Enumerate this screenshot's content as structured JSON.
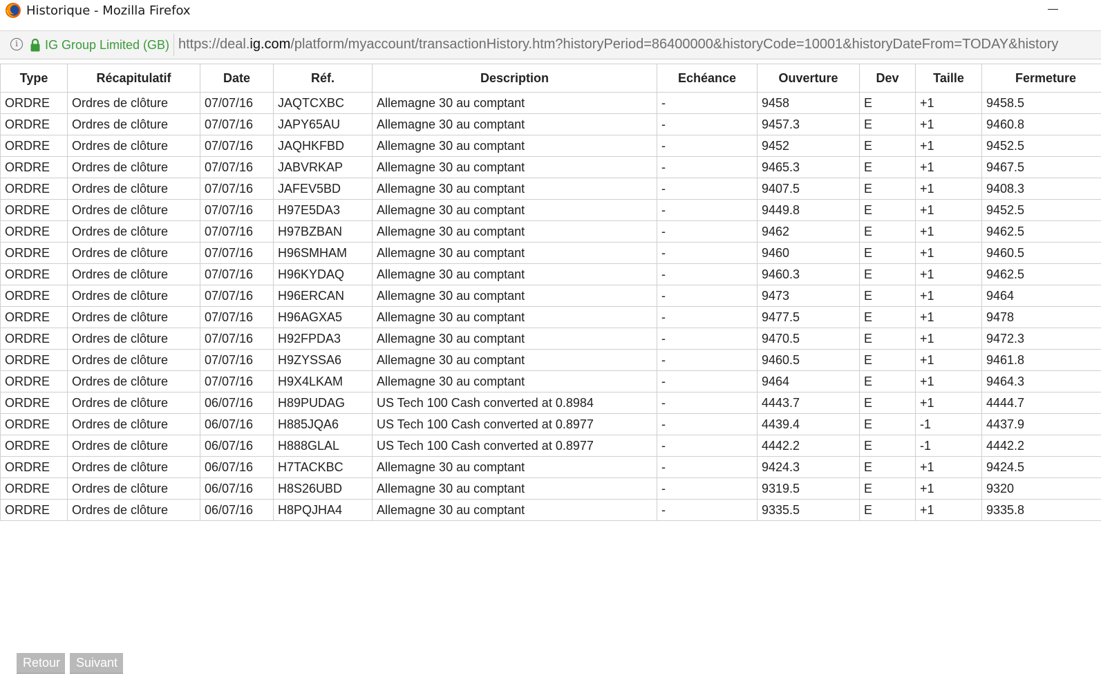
{
  "window": {
    "title": "Historique - Mozilla Firefox",
    "minimize_icon": "minimize-icon"
  },
  "urlbar": {
    "identity": "IG Group Limited (GB)",
    "url_prefix": "https://deal.",
    "url_domain": "ig.com",
    "url_rest": "/platform/myaccount/transactionHistory.htm?historyPeriod=86400000&historyCode=10001&historyDateFrom=TODAY&history",
    "identity_color": "#3a9b3a"
  },
  "table": {
    "headers": [
      "Type",
      "Récapitulatif",
      "Date",
      "Réf.",
      "Description",
      "Echéance",
      "Ouverture",
      "Dev",
      "Taille",
      "Fermeture"
    ],
    "rows": [
      [
        "ORDRE",
        "Ordres de clôture",
        "07/07/16",
        "JAQTCXBC",
        "Allemagne 30 au comptant",
        "-",
        "9458",
        "E",
        "+1",
        "9458.5"
      ],
      [
        "ORDRE",
        "Ordres de clôture",
        "07/07/16",
        "JAPY65AU",
        "Allemagne 30 au comptant",
        "-",
        "9457.3",
        "E",
        "+1",
        "9460.8"
      ],
      [
        "ORDRE",
        "Ordres de clôture",
        "07/07/16",
        "JAQHKFBD",
        "Allemagne 30 au comptant",
        "-",
        "9452",
        "E",
        "+1",
        "9452.5"
      ],
      [
        "ORDRE",
        "Ordres de clôture",
        "07/07/16",
        "JABVRKAP",
        "Allemagne 30 au comptant",
        "-",
        "9465.3",
        "E",
        "+1",
        "9467.5"
      ],
      [
        "ORDRE",
        "Ordres de clôture",
        "07/07/16",
        "JAFEV5BD",
        "Allemagne 30 au comptant",
        "-",
        "9407.5",
        "E",
        "+1",
        "9408.3"
      ],
      [
        "ORDRE",
        "Ordres de clôture",
        "07/07/16",
        "H97E5DA3",
        "Allemagne 30 au comptant",
        "-",
        "9449.8",
        "E",
        "+1",
        "9452.5"
      ],
      [
        "ORDRE",
        "Ordres de clôture",
        "07/07/16",
        "H97BZBAN",
        "Allemagne 30 au comptant",
        "-",
        "9462",
        "E",
        "+1",
        "9462.5"
      ],
      [
        "ORDRE",
        "Ordres de clôture",
        "07/07/16",
        "H96SMHAM",
        "Allemagne 30 au comptant",
        "-",
        "9460",
        "E",
        "+1",
        "9460.5"
      ],
      [
        "ORDRE",
        "Ordres de clôture",
        "07/07/16",
        "H96KYDAQ",
        "Allemagne 30 au comptant",
        "-",
        "9460.3",
        "E",
        "+1",
        "9462.5"
      ],
      [
        "ORDRE",
        "Ordres de clôture",
        "07/07/16",
        "H96ERCAN",
        "Allemagne 30 au comptant",
        "-",
        "9473",
        "E",
        "+1",
        "9464"
      ],
      [
        "ORDRE",
        "Ordres de clôture",
        "07/07/16",
        "H96AGXA5",
        "Allemagne 30 au comptant",
        "-",
        "9477.5",
        "E",
        "+1",
        "9478"
      ],
      [
        "ORDRE",
        "Ordres de clôture",
        "07/07/16",
        "H92FPDA3",
        "Allemagne 30 au comptant",
        "-",
        "9470.5",
        "E",
        "+1",
        "9472.3"
      ],
      [
        "ORDRE",
        "Ordres de clôture",
        "07/07/16",
        "H9ZYSSA6",
        "Allemagne 30 au comptant",
        "-",
        "9460.5",
        "E",
        "+1",
        "9461.8"
      ],
      [
        "ORDRE",
        "Ordres de clôture",
        "07/07/16",
        "H9X4LKAM",
        "Allemagne 30 au comptant",
        "-",
        "9464",
        "E",
        "+1",
        "9464.3"
      ],
      [
        "ORDRE",
        "Ordres de clôture",
        "06/07/16",
        "H89PUDAG",
        "US Tech 100 Cash converted at 0.8984",
        "-",
        "4443.7",
        "E",
        "+1",
        "4444.7"
      ],
      [
        "ORDRE",
        "Ordres de clôture",
        "06/07/16",
        "H885JQA6",
        "US Tech 100 Cash converted at 0.8977",
        "-",
        "4439.4",
        "E",
        "-1",
        "4437.9"
      ],
      [
        "ORDRE",
        "Ordres de clôture",
        "06/07/16",
        "H888GLAL",
        "US Tech 100 Cash converted at 0.8977",
        "-",
        "4442.2",
        "E",
        "-1",
        "4442.2"
      ],
      [
        "ORDRE",
        "Ordres de clôture",
        "06/07/16",
        "H7TACKBC",
        "Allemagne 30 au comptant",
        "-",
        "9424.3",
        "E",
        "+1",
        "9424.5"
      ],
      [
        "ORDRE",
        "Ordres de clôture",
        "06/07/16",
        "H8S26UBD",
        "Allemagne 30 au comptant",
        "-",
        "9319.5",
        "E",
        "+1",
        "9320"
      ],
      [
        "ORDRE",
        "Ordres de clôture",
        "06/07/16",
        "H8PQJHA4",
        "Allemagne 30 au comptant",
        "-",
        "9335.5",
        "E",
        "+1",
        "9335.8"
      ]
    ]
  },
  "footer": {
    "back_label": "Retour",
    "next_label": "Suivant"
  }
}
